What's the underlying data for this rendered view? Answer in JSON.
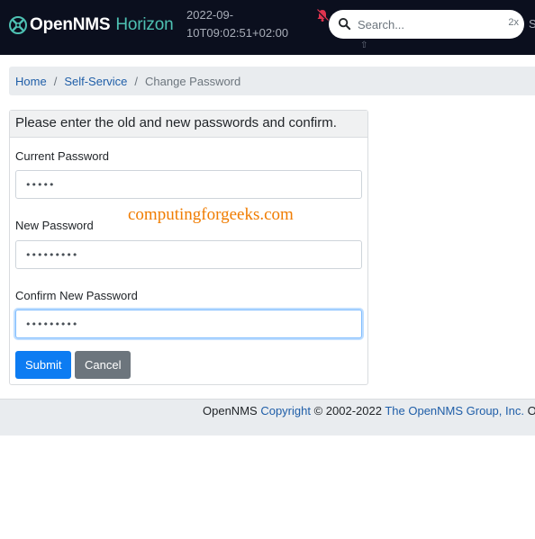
{
  "navbar": {
    "brand_open": "OpenNMS",
    "brand_horizon": "Horizon",
    "timestamp": "2022-09-10T09:02:51+02:00",
    "search_placeholder": "Search...",
    "search_hotkey": "2x",
    "truncated_item": "S",
    "caret": "⇧"
  },
  "breadcrumb": {
    "home": "Home",
    "separator": "/",
    "self_service": "Self-Service",
    "current": "Change Password"
  },
  "form": {
    "header": "Please enter the old and new passwords and confirm.",
    "current_password_label": "Current Password",
    "current_password_value": "•••••",
    "new_password_label": "New Password",
    "new_password_value": "•••••••••",
    "confirm_password_label": "Confirm New Password",
    "confirm_password_value": "•••••••••",
    "submit_label": "Submit",
    "cancel_label": "Cancel"
  },
  "watermark": "computingforgeeks.com",
  "footer": {
    "prefix": "OpenNMS",
    "copyright_link": "Copyright",
    "years": "© 2002-2022",
    "company_link": "The OpenNMS Group, Inc.",
    "suffix": "Ope"
  },
  "colors": {
    "navbar_bg": "#0b0f1e",
    "brand_accent": "#4ec1b3",
    "link": "#1f5ea8",
    "primary": "#0d7cf2",
    "secondary": "#6c757d",
    "alert_bell": "#e0344f",
    "watermark": "#f07c00"
  }
}
